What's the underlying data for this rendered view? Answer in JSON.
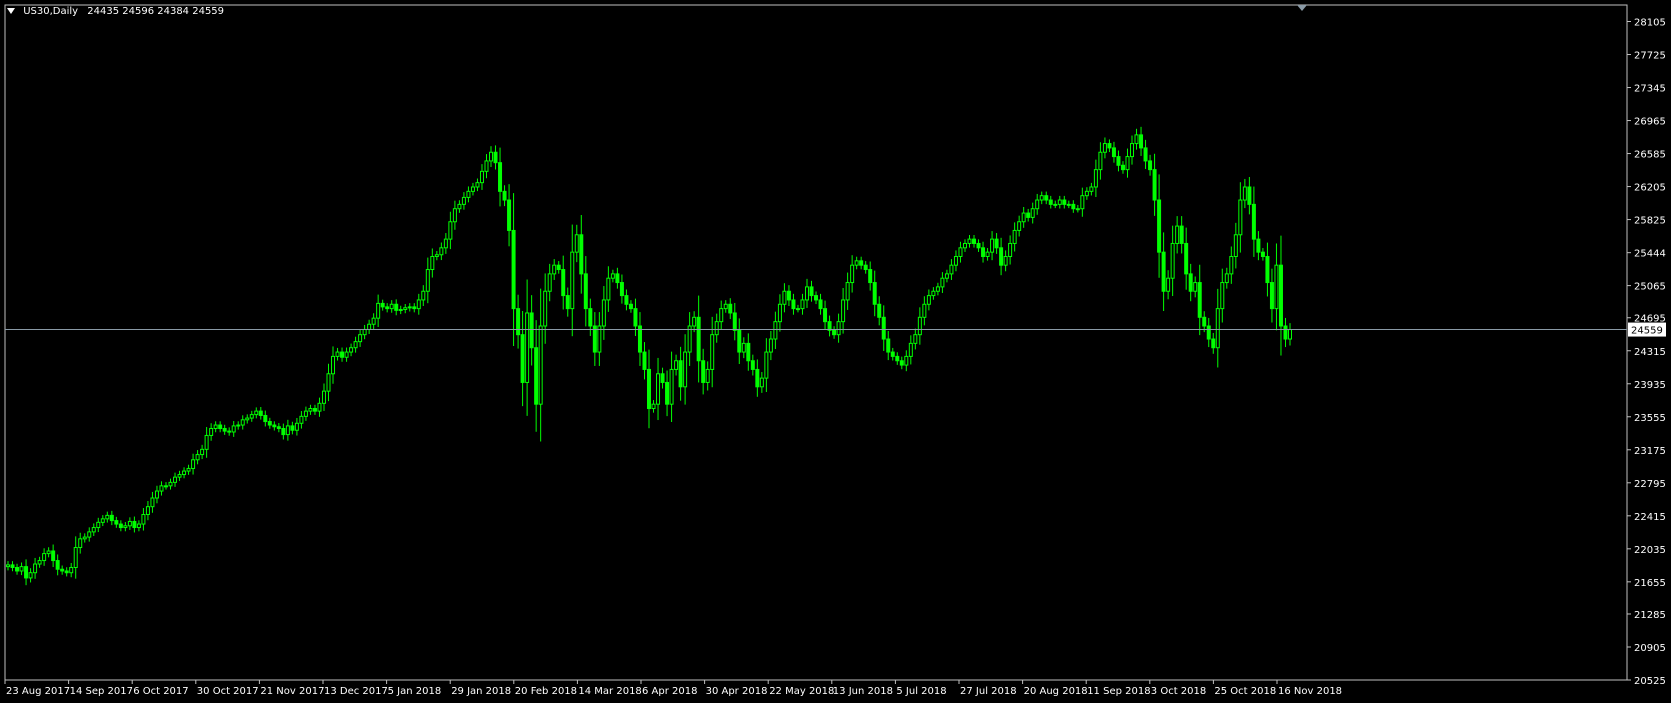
{
  "header": {
    "symbol": "US30,Daily",
    "ohlc": "24435 24596 24384 24559"
  },
  "colors": {
    "background": "#000000",
    "candle": "#00ff00",
    "axis": "#c0c0c0",
    "price_line": "#8a9aa6",
    "text": "#ffffff"
  },
  "chart_data": {
    "type": "candlestick",
    "title": "US30,Daily",
    "ylim": [
      20525,
      28295
    ],
    "yticks": [
      "28105",
      "27725",
      "27345",
      "26965",
      "26585",
      "26205",
      "25825",
      "25444",
      "25065",
      "24695",
      "24315",
      "23935",
      "23555",
      "23175",
      "22795",
      "22415",
      "22035",
      "21655",
      "21285",
      "20905",
      "20525"
    ],
    "xticks": [
      "23 Aug 2017",
      "14 Sep 2017",
      "6 Oct 2017",
      "30 Oct 2017",
      "21 Nov 2017",
      "13 Dec 2017",
      "5 Jan 2018",
      "29 Jan 2018",
      "20 Feb 2018",
      "14 Mar 2018",
      "6 Apr 2018",
      "30 Apr 2018",
      "22 May 2018",
      "13 Jun 2018",
      "5 Jul 2018",
      "27 Jul 2018",
      "20 Aug 2018",
      "11 Sep 2018",
      "3 Oct 2018",
      "25 Oct 2018",
      "16 Nov 2018"
    ],
    "last_price": "24559",
    "series": [
      {
        "values": [
          21850,
          21820,
          21780,
          21830,
          21700,
          21760,
          21860,
          21900,
          21980,
          22010,
          21900,
          21800,
          21780,
          21760,
          21820,
          22050,
          22150,
          22170,
          22230,
          22280,
          22340,
          22380,
          22420,
          22360,
          22320,
          22280,
          22300,
          22350,
          22280,
          22320,
          22430,
          22520,
          22620,
          22700,
          22760,
          22760,
          22800,
          22860,
          22890,
          22930,
          22960,
          23060,
          23120,
          23180,
          23340,
          23420,
          23460,
          23420,
          23390,
          23380,
          23450,
          23460,
          23520,
          23540,
          23580,
          23620,
          23570,
          23500,
          23460,
          23440,
          23420,
          23350,
          23450,
          23400,
          23480,
          23560,
          23620,
          23650,
          23620,
          23710,
          23850,
          24050,
          24250,
          24300,
          24240,
          24300,
          24350,
          24420,
          24500,
          24560,
          24620,
          24690,
          24860,
          24820,
          24800,
          24850,
          24780,
          24790,
          24810,
          24820,
          24800,
          24900,
          25000,
          25250,
          25400,
          25420,
          25500,
          25600,
          25800,
          25950,
          26000,
          26080,
          26150,
          26200,
          26250,
          26380,
          26500,
          26600,
          26480,
          26150,
          26050,
          25700,
          24800,
          24500,
          23950,
          24750,
          24350,
          23700,
          24600,
          25000,
          25200,
          25300,
          25250,
          24950,
          24800,
          25450,
          25650,
          25200,
          24800,
          24600,
          24300,
          24600,
          24900,
          25150,
          25200,
          25100,
          24950,
          24850,
          24800,
          24600,
          24300,
          24100,
          23650,
          23700,
          24050,
          23950,
          23700,
          24100,
          24200,
          23900,
          24300,
          24600,
          24700,
          24200,
          23950,
          24100,
          24500,
          24650,
          24800,
          24850,
          24750,
          24550,
          24300,
          24400,
          24200,
          24100,
          23900,
          24000,
          24300,
          24450,
          24650,
          24850,
          25000,
          24900,
          24800,
          24800,
          24900,
          25050,
          24950,
          24900,
          24800,
          24650,
          24550,
          24500,
          24650,
          24900,
          25100,
          25300,
          25350,
          25300,
          25250,
          25100,
          24850,
          24700,
          24450,
          24300,
          24250,
          24200,
          24150,
          24250,
          24400,
          24500,
          24700,
          24850,
          24950,
          25000,
          25050,
          25150,
          25200,
          25300,
          25400,
          25500,
          25550,
          25600,
          25550,
          25500,
          25400,
          25450,
          25600,
          25500,
          25300,
          25400,
          25550,
          25700,
          25800,
          25900,
          25850,
          25950,
          26050,
          26100,
          26050,
          26000,
          26000,
          26050,
          26000,
          26000,
          25950,
          25950,
          26100,
          26150,
          26200,
          26400,
          26600,
          26700,
          26650,
          26550,
          26450,
          26400,
          26550,
          26700,
          26800,
          26650,
          26500,
          26400,
          26050,
          25450,
          25000,
          25150,
          25550,
          25750,
          25550,
          25200,
          25000,
          25100,
          24700,
          24600,
          24450,
          24350,
          24800,
          25100,
          25200,
          25400,
          25650,
          26050,
          26200,
          26000,
          25600,
          25450,
          25400,
          25100,
          24800,
          25300,
          24600,
          24450,
          24559
        ]
      }
    ]
  }
}
